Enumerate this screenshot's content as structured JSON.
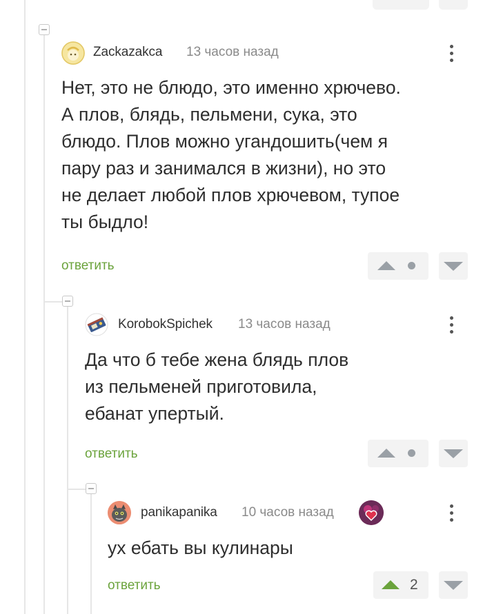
{
  "comments": [
    {
      "author": "Zackazakca",
      "time": "13 часов назад",
      "text": "Нет, это не блюдо, это именно хрючево.\nА плов, блядь, пельмени, сука, это\nблюдо. Плов можно угандошить(чем я\nпару раз и занимался в жизни), но это\nне делает любой плов хрючевом, тупое\nты быдло!",
      "reply_label": "ответить",
      "rating": ""
    },
    {
      "author": "KorobokSpichek",
      "time": "13 часов назад",
      "text": "Да что б тебе жена блядь плов\nиз пельменей приготовила,\nебанат упертый.",
      "reply_label": "ответить",
      "rating": ""
    },
    {
      "author": "panikapanika",
      "time": "10 часов назад",
      "text": "ух ебать вы кулинары",
      "reply_label": "ответить",
      "rating": "2"
    }
  ],
  "icons": {
    "collapse": "collapse-toggle-icon",
    "menu": "more-vertical-icon",
    "upvote": "upvote-arrow-icon",
    "downvote": "downvote-arrow-icon",
    "neutral": "neutral-dot-icon"
  },
  "colors": {
    "reply": "#6ba33c",
    "upvote_active": "#6ba33c",
    "vote_inactive": "#9aa0a6"
  }
}
